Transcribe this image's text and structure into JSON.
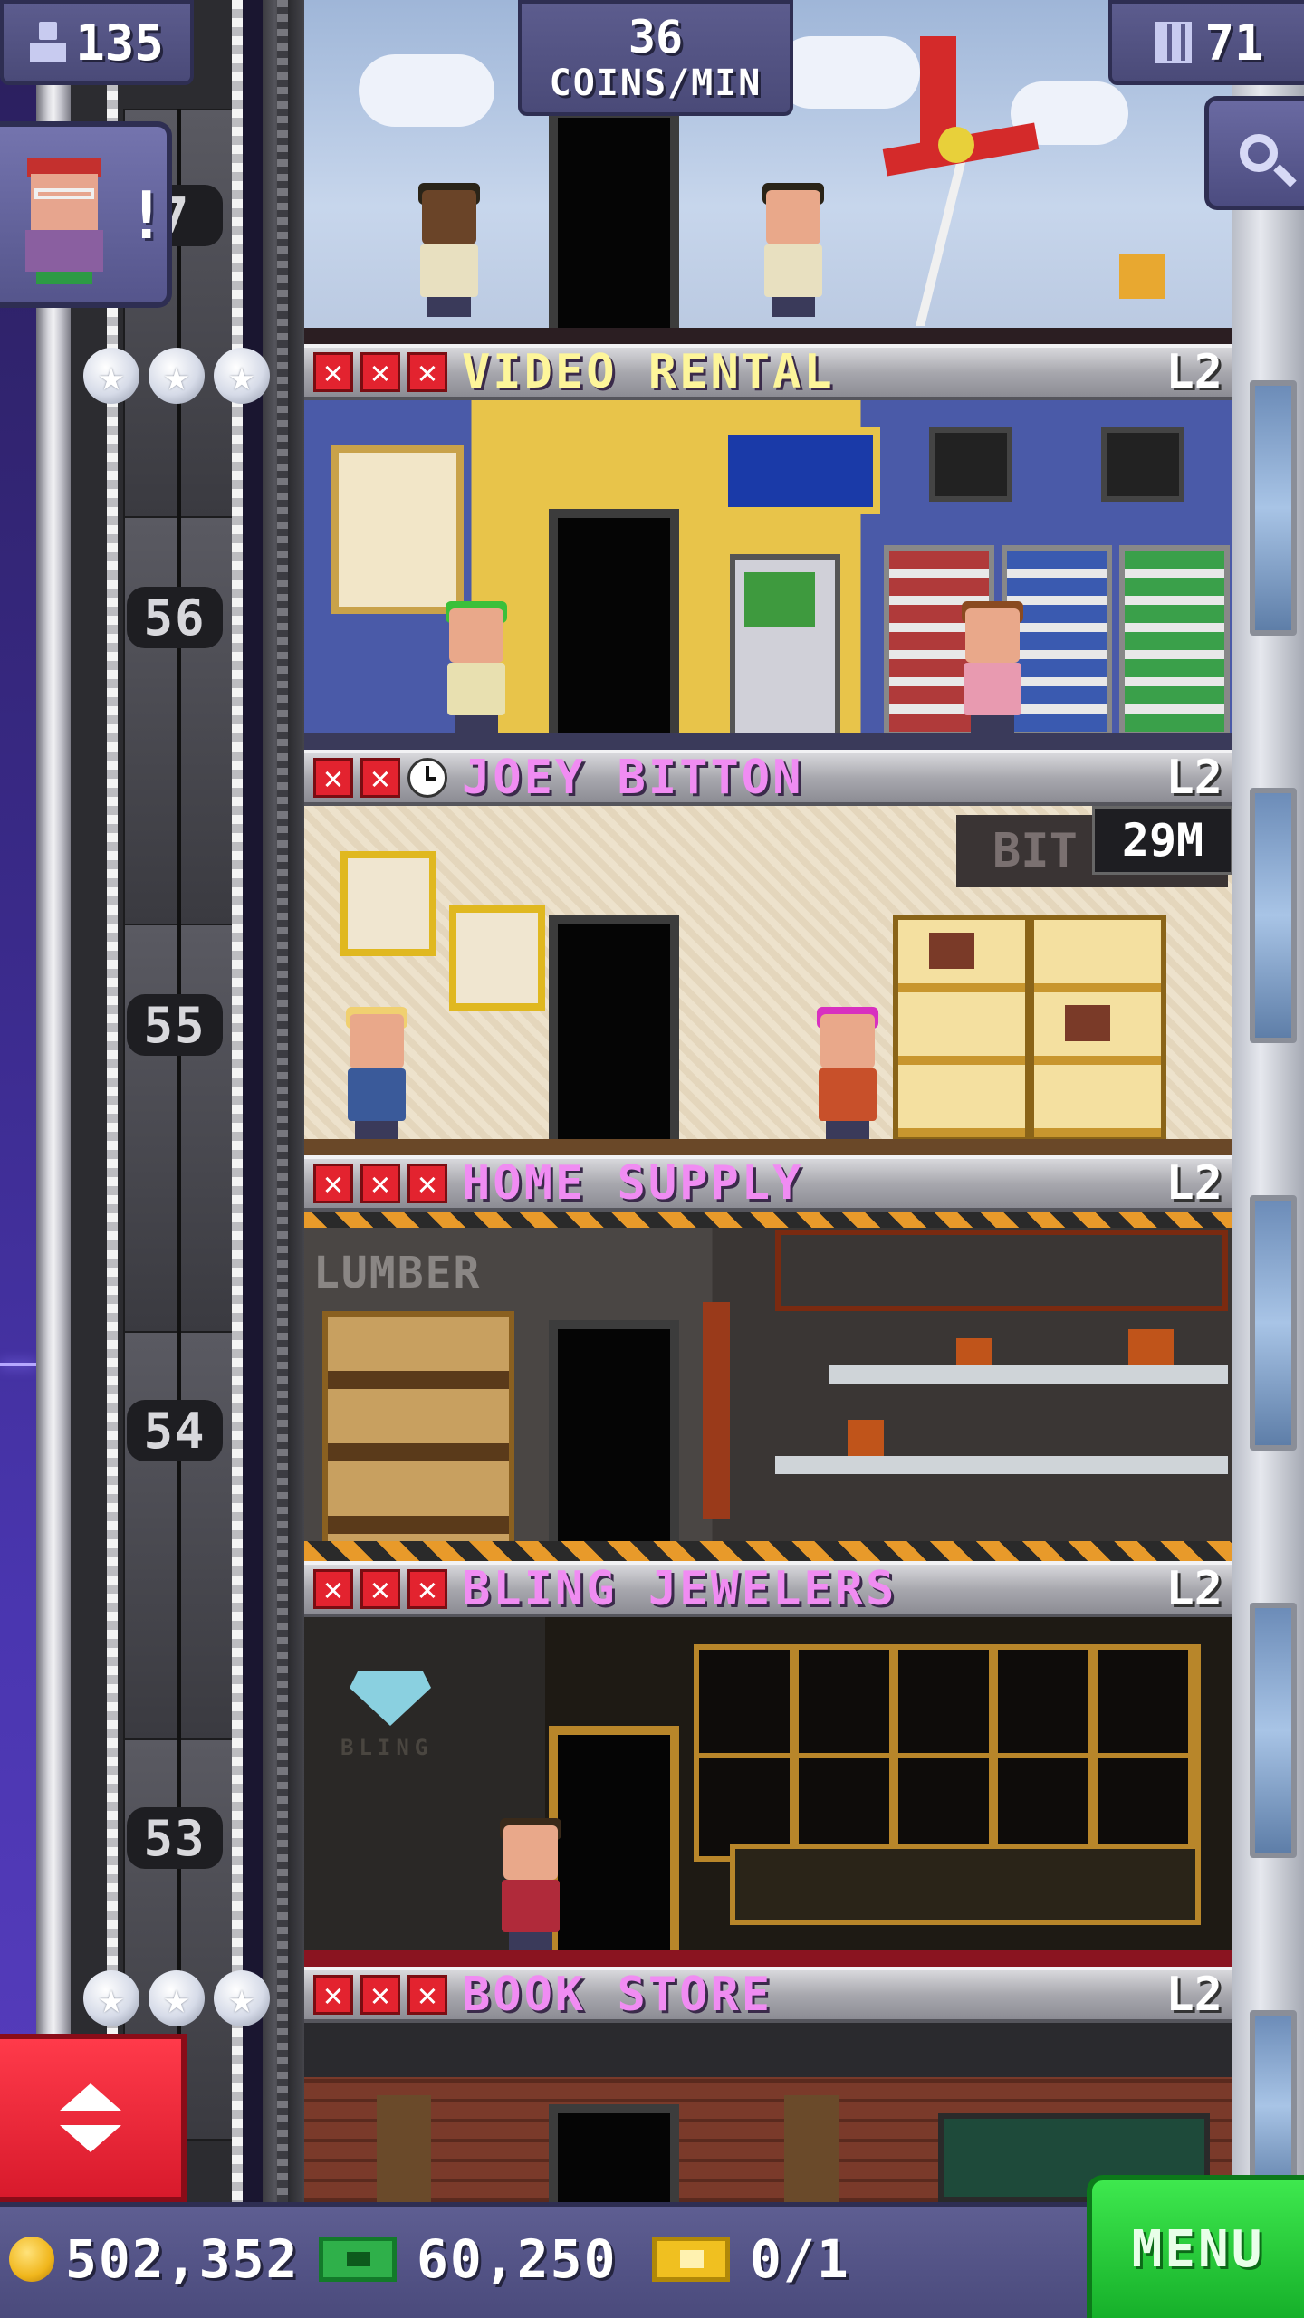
{
  "hud": {
    "population": "135",
    "coins_per_min_value": "36",
    "coins_per_min_label": "COINS/MIN",
    "floor_count": "71"
  },
  "mission": {
    "alert": "!"
  },
  "shaft": {
    "floor_numbers": [
      "7",
      "56",
      "55",
      "54",
      "53"
    ]
  },
  "floors": [
    {
      "name": "VIDEO RENTAL",
      "level": "L2",
      "name_color": "#fdf59a"
    },
    {
      "name": "JOEY BITTON",
      "level": "L2",
      "name_color": "#f08cf2",
      "timer": "29M",
      "sign": "BIT"
    },
    {
      "name": "HOME SUPPLY",
      "level": "L2",
      "name_color": "#f08cf2",
      "sign": "LUMBER"
    },
    {
      "name": "BLING JEWELERS",
      "level": "L2",
      "name_color": "#f08cf2",
      "sign": "BLING"
    },
    {
      "name": "BOOK STORE",
      "level": "L2",
      "name_color": "#f08cf2"
    }
  ],
  "bottom": {
    "coins": "502,352",
    "bux": "60,250",
    "tickets": "0/1",
    "menu_label": "MENU"
  },
  "icons": {
    "population": "person-icon",
    "floors": "building-icon",
    "search": "magnifier-icon",
    "elevator": "up-down-arrows-icon",
    "coin": "coin-icon",
    "bux": "bux-icon",
    "ticket": "golden-ticket-icon",
    "status_bad": "red-x-icon",
    "status_pending": "clock-icon"
  }
}
